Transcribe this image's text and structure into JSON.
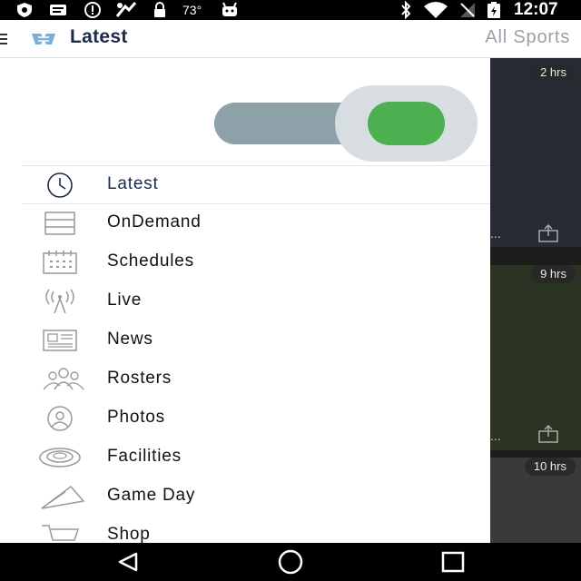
{
  "status_bar": {
    "temperature": "73°",
    "time": "12:07",
    "icons": [
      "shield-icon",
      "message-icon",
      "alert-icon",
      "fantasy-icon",
      "lock-icon",
      "temperature-text",
      "android-icon",
      "bluetooth-icon",
      "wifi-icon",
      "no-signal-icon",
      "battery-charging-icon"
    ]
  },
  "toolbar": {
    "title": "Latest",
    "right_label": "All Sports"
  },
  "background_cards": [
    {
      "time": "2 hrs"
    },
    {
      "time": "9 hrs"
    },
    {
      "time": "10 hrs"
    }
  ],
  "drawer": {
    "toggle_on": true,
    "accent_color": "#4caf50",
    "items": [
      {
        "label": "Latest",
        "icon": "clock-icon",
        "active": true
      },
      {
        "label": "OnDemand",
        "icon": "stack-icon"
      },
      {
        "label": "Schedules",
        "icon": "calendar-icon"
      },
      {
        "label": "Live",
        "icon": "broadcast-icon"
      },
      {
        "label": "News",
        "icon": "newspaper-icon"
      },
      {
        "label": "Rosters",
        "icon": "people-icon"
      },
      {
        "label": "Photos",
        "icon": "person-circle-icon"
      },
      {
        "label": "Facilities",
        "icon": "stadium-icon"
      },
      {
        "label": "Game Day",
        "icon": "pennant-icon"
      },
      {
        "label": "Shop",
        "icon": "cart-icon"
      }
    ]
  },
  "nav_bar": {
    "buttons": [
      "back-icon",
      "home-icon",
      "recents-icon"
    ]
  }
}
